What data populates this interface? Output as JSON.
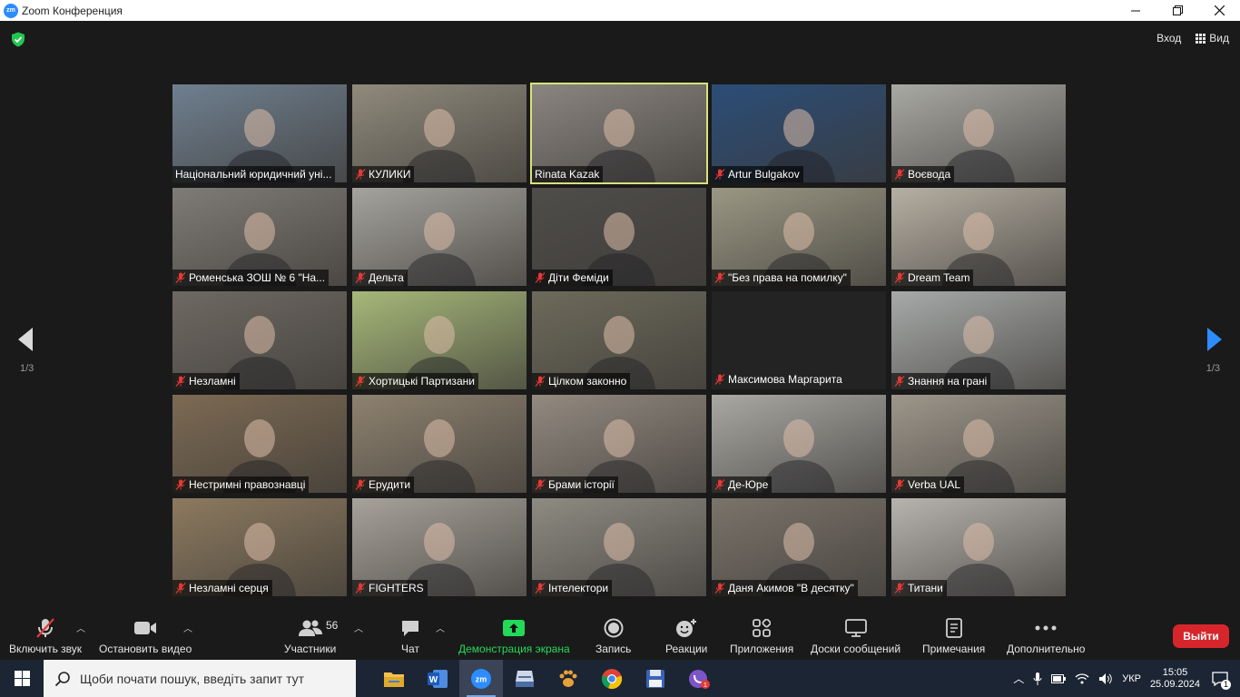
{
  "window": {
    "app_logo": "zm",
    "title": "Zoom Конференция",
    "controls": [
      "minimize-icon",
      "maximize-icon",
      "close-icon"
    ]
  },
  "meeting_header": {
    "security_icon": "shield-check-icon",
    "exit_fullscreen_label": "Вход",
    "view_label": "Вид"
  },
  "pagination": {
    "left": "1/3",
    "right": "1/3"
  },
  "participants": [
    {
      "name": "Національний юридичний уні...",
      "muted": false,
      "active": false,
      "bg": "#6f7f8f"
    },
    {
      "name": "КУЛИКИ",
      "muted": true,
      "active": false,
      "bg": "#8f8a7c"
    },
    {
      "name": "Rinata Kazak",
      "muted": false,
      "active": true,
      "bg": "#8a8580"
    },
    {
      "name": "Artur Bulgakov",
      "muted": true,
      "active": false,
      "bg": "#2c4d77"
    },
    {
      "name": "Воєвода",
      "muted": true,
      "active": false,
      "bg": "#a9a9a4"
    },
    {
      "name": "Роменська ЗОШ № 6 \"На...",
      "muted": true,
      "active": false,
      "bg": "#7f7b76"
    },
    {
      "name": "Дельта",
      "muted": true,
      "active": false,
      "bg": "#a5a39d"
    },
    {
      "name": "Діти Феміди",
      "muted": true,
      "active": false,
      "bg": "#4f4d4a"
    },
    {
      "name": "\"Без права на помилку\"",
      "muted": true,
      "active": false,
      "bg": "#9a9784"
    },
    {
      "name": "Dream Team",
      "muted": true,
      "active": false,
      "bg": "#b6b0a3"
    },
    {
      "name": "Незламні",
      "muted": true,
      "active": false,
      "bg": "#6e6962"
    },
    {
      "name": "Хортицькі Партизани",
      "muted": true,
      "active": false,
      "bg": "#a6b879"
    },
    {
      "name": "Цілком законно",
      "muted": true,
      "active": false,
      "bg": "#6d6a5b"
    },
    {
      "name": "Максимова Маргарита",
      "muted": true,
      "active": false,
      "bg": "#232323",
      "empty": true
    },
    {
      "name": "Знання на грані",
      "muted": true,
      "active": false,
      "bg": "#a7aaa9"
    },
    {
      "name": "Нестримні правознавці",
      "muted": true,
      "active": false,
      "bg": "#7c6a53"
    },
    {
      "name": "Ерудити",
      "muted": true,
      "active": false,
      "bg": "#8e8270"
    },
    {
      "name": "Брами історії",
      "muted": true,
      "active": false,
      "bg": "#938a80"
    },
    {
      "name": "Де-Юре",
      "muted": true,
      "active": false,
      "bg": "#a9a8a3"
    },
    {
      "name": "Verba UAL",
      "muted": true,
      "active": false,
      "bg": "#9d978b"
    },
    {
      "name": "Незламні серця",
      "muted": true,
      "active": false,
      "bg": "#8c7a5f"
    },
    {
      "name": "FIGHTERS",
      "muted": true,
      "active": false,
      "bg": "#a7a29a"
    },
    {
      "name": "Інтелектори",
      "muted": true,
      "active": false,
      "bg": "#8e8b82"
    },
    {
      "name": "Даня Акимов \"В десятку\"",
      "muted": true,
      "active": false,
      "bg": "#7a746a"
    },
    {
      "name": "Титани",
      "muted": true,
      "active": false,
      "bg": "#b7b3ad"
    }
  ],
  "toolbar": {
    "mute_label": "Включить звук",
    "video_label": "Остановить видео",
    "participants_label": "Участники",
    "participants_count": "56",
    "chat_label": "Чат",
    "share_label": "Демонстрация экрана",
    "record_label": "Запись",
    "reactions_label": "Реакции",
    "apps_label": "Приложения",
    "whiteboards_label": "Доски сообщений",
    "notes_label": "Примечания",
    "more_label": "Дополнительно",
    "leave_label": "Выйти",
    "colors": {
      "share": "#23d959",
      "leave": "#d6262b",
      "active_border": "#d8e27a",
      "mute_red": "#e53935"
    }
  },
  "taskbar": {
    "search_placeholder": "Щоби почати пошук, введіть запит тут",
    "apps": [
      "file-explorer-icon",
      "word-icon",
      "zoom-icon",
      "scanner-icon",
      "paw-app-icon",
      "chrome-icon",
      "save-disk-icon",
      "viber-icon"
    ],
    "active_app": "zoom-icon",
    "viber_badge": "1",
    "language": "УКР",
    "time": "15:05",
    "date": "25.09.2024",
    "notification_count": "1"
  }
}
